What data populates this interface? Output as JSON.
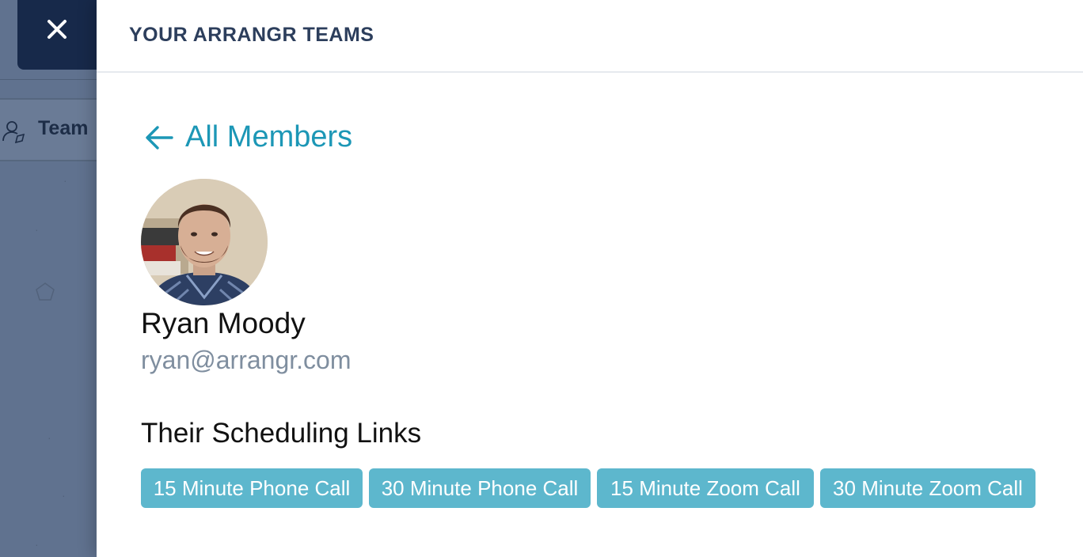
{
  "background_app": {
    "tab_label": "Team"
  },
  "close_button": {
    "icon": "close-icon",
    "symbol": "✕"
  },
  "panel": {
    "title": "YOUR ARRANGR TEAMS",
    "back_link": {
      "icon": "arrow-left-icon",
      "label": "All Members"
    },
    "member": {
      "name": "Ryan Moody",
      "email": "ryan@arrangr.com"
    },
    "scheduling": {
      "heading": "Their Scheduling Links",
      "links": [
        "15 Minute Phone Call",
        "30 Minute Phone Call",
        "15 Minute Zoom Call",
        "30 Minute Zoom Call"
      ]
    }
  },
  "colors": {
    "accent": "#1c97b6",
    "pill": "#5db7cd",
    "close_bg": "#17294a",
    "overlay": "#60728f"
  }
}
